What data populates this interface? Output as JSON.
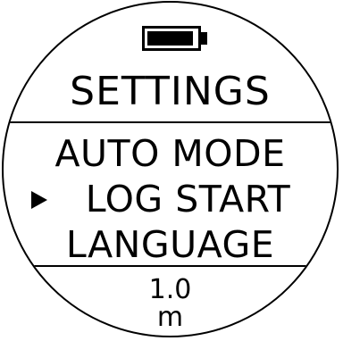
{
  "status": {
    "battery_icon": "battery-full-icon",
    "battery_level": 0.9
  },
  "header": {
    "title": "SETTINGS"
  },
  "menu": {
    "items": [
      {
        "label": "AUTO MODE"
      },
      {
        "label": "LOG START"
      },
      {
        "label": "LANGUAGE"
      }
    ],
    "selected_index": 1,
    "cursor_icon": "triangle-right-icon"
  },
  "footer": {
    "value": "1.0",
    "unit": "m"
  }
}
